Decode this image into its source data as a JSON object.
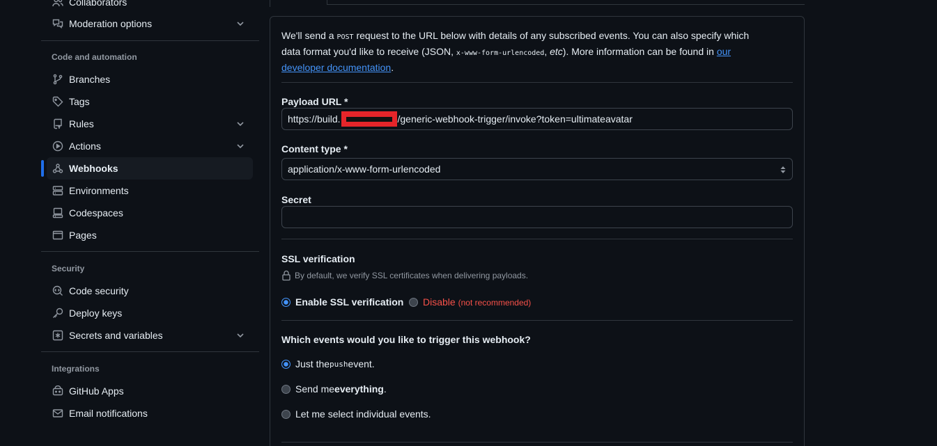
{
  "sidebar": {
    "items_top": [
      {
        "label": "Collaborators",
        "icon": "people-icon"
      },
      {
        "label": "Moderation options",
        "icon": "comment-discussion-icon",
        "expandable": true
      }
    ],
    "code_automation": {
      "heading": "Code and automation",
      "items": [
        {
          "label": "Branches",
          "icon": "git-branch-icon"
        },
        {
          "label": "Tags",
          "icon": "tag-icon"
        },
        {
          "label": "Rules",
          "icon": "repo-push-icon",
          "expandable": true
        },
        {
          "label": "Actions",
          "icon": "play-icon",
          "expandable": true
        },
        {
          "label": "Webhooks",
          "icon": "webhook-icon",
          "active": true
        },
        {
          "label": "Environments",
          "icon": "server-icon"
        },
        {
          "label": "Codespaces",
          "icon": "codespaces-icon"
        },
        {
          "label": "Pages",
          "icon": "browser-icon"
        }
      ]
    },
    "security": {
      "heading": "Security",
      "items": [
        {
          "label": "Code security",
          "icon": "codescan-icon"
        },
        {
          "label": "Deploy keys",
          "icon": "key-icon"
        },
        {
          "label": "Secrets and variables",
          "icon": "key-asterisk-icon",
          "expandable": true
        }
      ]
    },
    "integrations": {
      "heading": "Integrations",
      "items": [
        {
          "label": "GitHub Apps",
          "icon": "apps-icon"
        },
        {
          "label": "Email notifications",
          "icon": "mail-icon"
        }
      ]
    }
  },
  "form": {
    "intro": {
      "part1": "We'll send a ",
      "code1": "POST",
      "part2": " request to the URL below with details of any subscribed events. You can also specify which data format you'd like to receive (JSON, ",
      "code2": "x-www-form-urlencoded",
      "part3": ", ",
      "etc": "etc",
      "part4": "). More information can be found in ",
      "link": "our developer documentation",
      "part5": "."
    },
    "payload_url": {
      "label": "Payload URL *",
      "value_prefix": "https://build.",
      "value_suffix": "/generic-webhook-trigger/invoke?token=ultimateavatar"
    },
    "content_type": {
      "label": "Content type *",
      "selected": "application/x-www-form-urlencoded"
    },
    "secret": {
      "label": "Secret",
      "value": ""
    },
    "ssl": {
      "label": "SSL verification",
      "note": "By default, we verify SSL certificates when delivering payloads.",
      "enable_label": "Enable SSL verification",
      "disable_label": "Disable",
      "disable_note": "(not recommended)",
      "selected": "enable"
    },
    "events": {
      "question": "Which events would you like to trigger this webhook?",
      "options": [
        {
          "pre": "Just the ",
          "code": "push",
          "post": " event.",
          "checked": true
        },
        {
          "pre": "Send me ",
          "bold": "everything",
          "post": ".",
          "checked": false
        },
        {
          "pre": "Let me select individual events.",
          "checked": false
        }
      ]
    }
  }
}
